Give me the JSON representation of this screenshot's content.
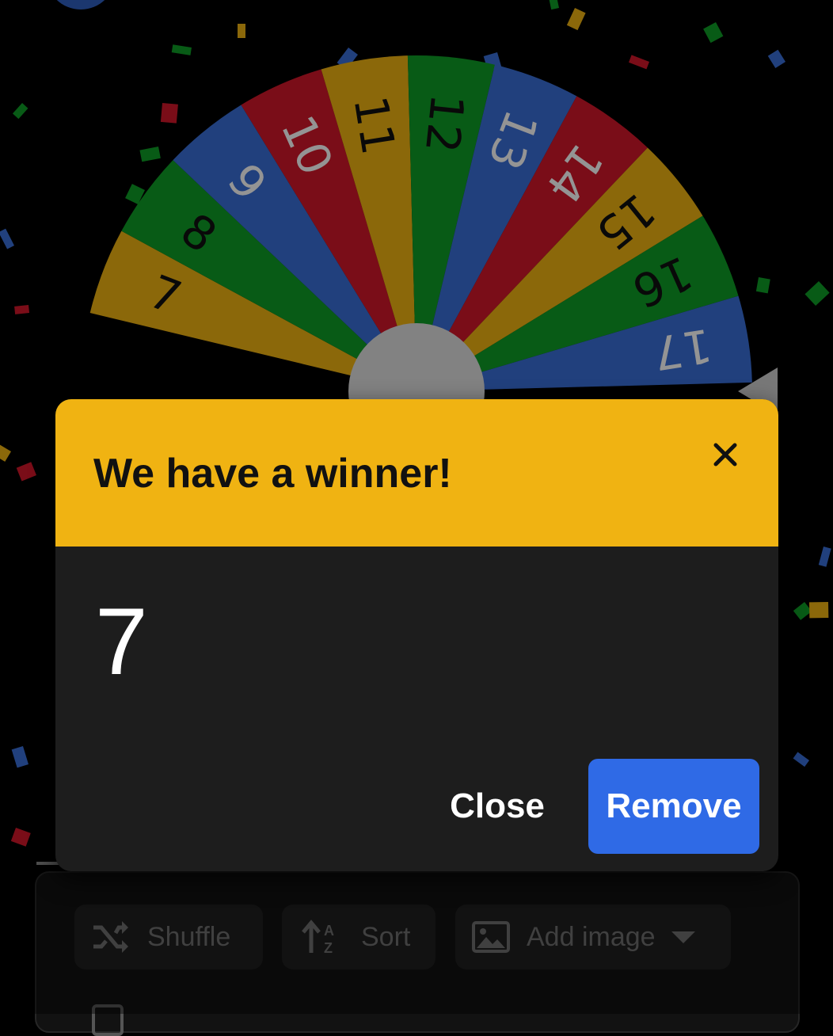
{
  "wheel": {
    "visible_segments": [
      {
        "label": "7",
        "color": "#f0b312"
      },
      {
        "label": "8",
        "color": "#0f9d26"
      },
      {
        "label": "9",
        "color": "#3a6fd8"
      },
      {
        "label": "10",
        "color": "#d2182a"
      },
      {
        "label": "11",
        "color": "#f0b312"
      },
      {
        "label": "12",
        "color": "#0f9d26"
      },
      {
        "label": "13",
        "color": "#3a6fd8"
      },
      {
        "label": "14",
        "color": "#d2182a"
      },
      {
        "label": "15",
        "color": "#f0b312"
      },
      {
        "label": "16",
        "color": "#0f9d26"
      },
      {
        "label": "17",
        "color": "#3a6fd8"
      }
    ],
    "center_color": "#e0e0e0",
    "pointer_color": "#cfcfcf"
  },
  "dialog": {
    "title": "We have a winner!",
    "winner": "7",
    "close_label": "Close",
    "remove_label": "Remove",
    "header_color": "#f0b312",
    "remove_color": "#2f6ae6"
  },
  "toolbar": {
    "shuffle_label": "Shuffle",
    "sort_label": "Sort",
    "add_image_label": "Add image"
  }
}
